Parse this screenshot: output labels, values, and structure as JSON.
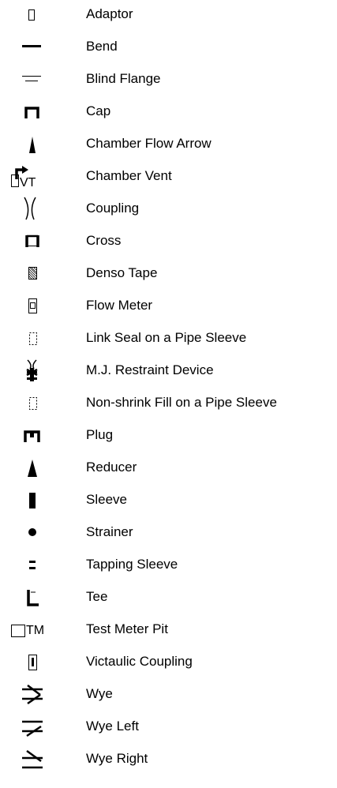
{
  "legend": {
    "items": [
      {
        "icon": "adaptor-icon",
        "label": "Adaptor"
      },
      {
        "icon": "bend-icon",
        "label": "Bend"
      },
      {
        "icon": "blind-flange-icon",
        "label": "Blind Flange"
      },
      {
        "icon": "cap-icon",
        "label": "Cap"
      },
      {
        "icon": "chamber-flow-arrow-icon",
        "label": "Chamber Flow Arrow"
      },
      {
        "icon": "chamber-vent-icon",
        "label": "Chamber Vent",
        "symbol_text": "VT"
      },
      {
        "icon": "coupling-icon",
        "label": "Coupling"
      },
      {
        "icon": "cross-icon",
        "label": "Cross"
      },
      {
        "icon": "denso-tape-icon",
        "label": "Denso Tape"
      },
      {
        "icon": "flow-meter-icon",
        "label": "Flow Meter"
      },
      {
        "icon": "link-seal-icon",
        "label": "Link Seal on a Pipe Sleeve"
      },
      {
        "icon": "mj-restraint-icon",
        "label": "M.J. Restraint Device"
      },
      {
        "icon": "non-shrink-fill-icon",
        "label": "Non-shrink Fill on a Pipe Sleeve"
      },
      {
        "icon": "plug-icon",
        "label": "Plug"
      },
      {
        "icon": "reducer-icon",
        "label": "Reducer"
      },
      {
        "icon": "sleeve-icon",
        "label": "Sleeve"
      },
      {
        "icon": "strainer-icon",
        "label": "Strainer"
      },
      {
        "icon": "tapping-sleeve-icon",
        "label": "Tapping Sleeve"
      },
      {
        "icon": "tee-icon",
        "label": "Tee"
      },
      {
        "icon": "test-meter-pit-icon",
        "label": "Test Meter Pit",
        "symbol_text": "TM"
      },
      {
        "icon": "victaulic-coupling-icon",
        "label": "Victaulic Coupling"
      },
      {
        "icon": "wye-icon",
        "label": "Wye"
      },
      {
        "icon": "wye-left-icon",
        "label": "Wye Left"
      },
      {
        "icon": "wye-right-icon",
        "label": "Wye Right"
      }
    ]
  }
}
